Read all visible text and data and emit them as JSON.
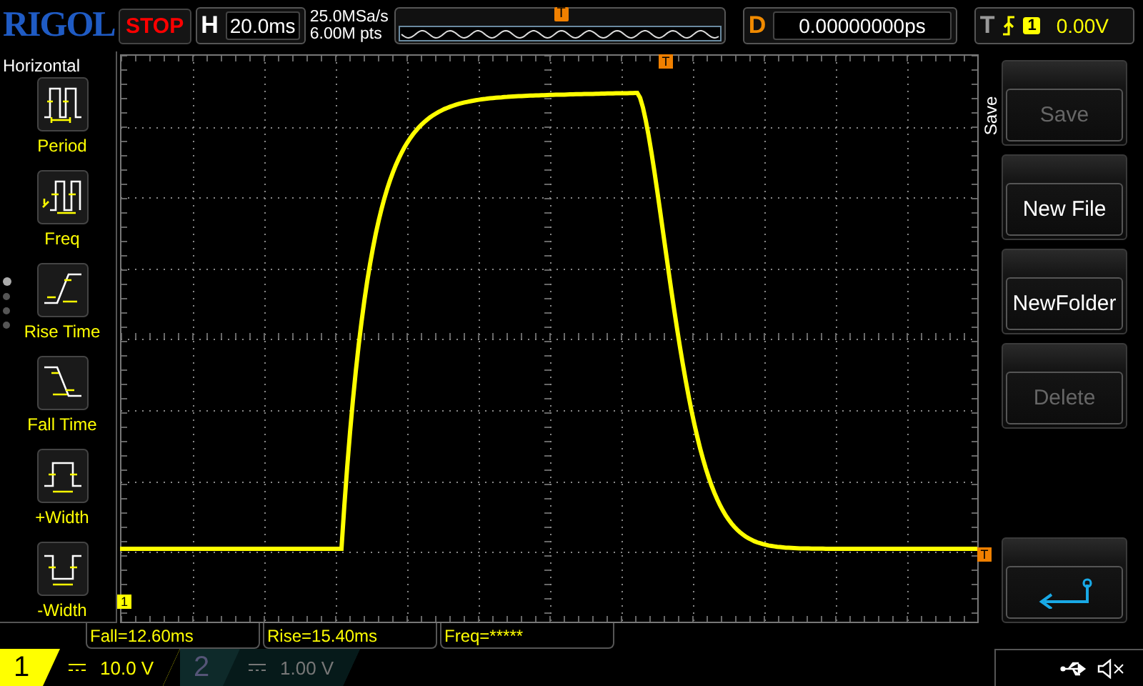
{
  "top": {
    "logo": "RIGOL",
    "run_state": "STOP",
    "timebase_label": "H",
    "timebase": "20.0ms",
    "sample_rate": "25.0MSa/s",
    "memory_depth": "6.00M pts",
    "overview_marker": "T",
    "delay_label": "D",
    "delay": "0.00000000ps",
    "trigger_label": "T",
    "trigger_source": "1",
    "trigger_level": "0.00V"
  },
  "left_menu": {
    "title": "Horizontal",
    "items": [
      {
        "kind": "period",
        "label": "Period"
      },
      {
        "kind": "freq",
        "label": "Freq"
      },
      {
        "kind": "rise",
        "label": "Rise Time"
      },
      {
        "kind": "fall",
        "label": "Fall Time"
      },
      {
        "kind": "pwidth",
        "label": "+Width"
      },
      {
        "kind": "nwidth",
        "label": "-Width"
      }
    ],
    "pages": [
      {
        "selected": true
      },
      {
        "selected": false
      },
      {
        "selected": false
      },
      {
        "selected": false
      }
    ]
  },
  "screen": {
    "trigger_position_marker": "T",
    "channel_marker": "1",
    "trigger_level_marker": "T"
  },
  "measurements": [
    "Fall=12.60ms",
    "Rise=15.40ms",
    "Freq=*****"
  ],
  "channels": [
    {
      "number": "1",
      "scale": "10.0 V",
      "on": true
    },
    {
      "number": "2",
      "scale": "1.00 V",
      "on": false
    }
  ],
  "right_menu": {
    "title": "Save",
    "buttons": [
      {
        "kind": "text",
        "label": "Save",
        "disabled": true
      },
      {
        "kind": "text",
        "label": "New File",
        "disabled": false
      },
      {
        "kind": "text",
        "label": "NewFolder",
        "disabled": false
      },
      {
        "kind": "text",
        "label": "Delete",
        "disabled": true
      },
      {
        "kind": "back"
      }
    ]
  }
}
